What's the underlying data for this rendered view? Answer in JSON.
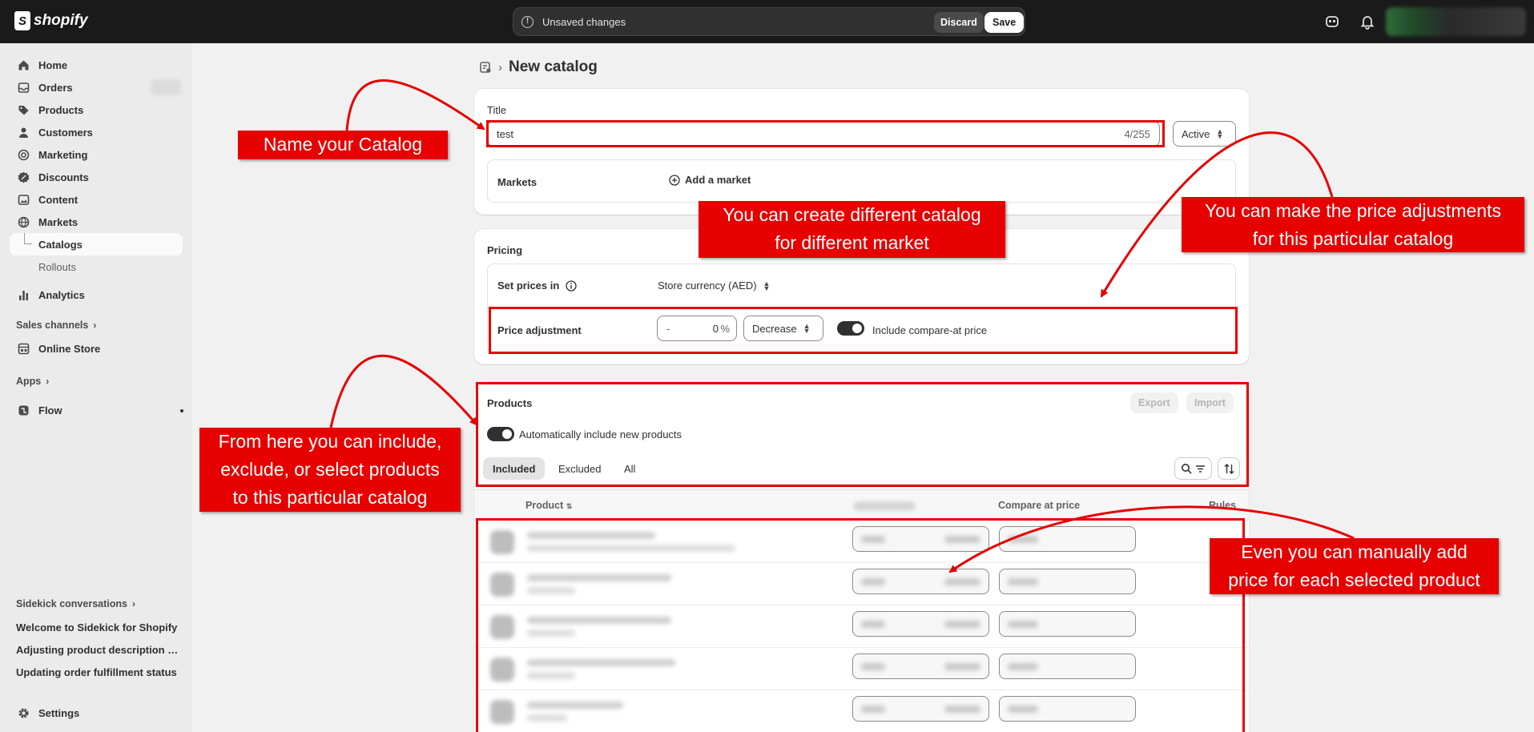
{
  "topbar": {
    "brand": "shopify",
    "status_message": "Unsaved changes",
    "discard_label": "Discard",
    "save_label": "Save"
  },
  "sidebar": {
    "items": [
      {
        "label": "Home",
        "icon": "home-icon"
      },
      {
        "label": "Orders",
        "icon": "orders-icon"
      },
      {
        "label": "Products",
        "icon": "tag-icon"
      },
      {
        "label": "Customers",
        "icon": "person-icon"
      },
      {
        "label": "Marketing",
        "icon": "target-icon"
      },
      {
        "label": "Discounts",
        "icon": "discount-icon"
      },
      {
        "label": "Content",
        "icon": "content-icon"
      },
      {
        "label": "Markets",
        "icon": "globe-icon"
      }
    ],
    "markets_sub": [
      "Catalogs",
      "Rollouts"
    ],
    "analytics": "Analytics",
    "sales_channels": "Sales channels",
    "online_store": "Online Store",
    "apps": "Apps",
    "flow": "Flow",
    "sidekick_head": "Sidekick conversations",
    "sidekick_items": [
      "Welcome to Sidekick for Shopify",
      "Adjusting product description tags",
      "Updating order fulfillment status"
    ],
    "settings": "Settings"
  },
  "page": {
    "title": "New catalog",
    "title_card": {
      "label": "Title",
      "value": "test",
      "counter": "4/255",
      "status": "Active",
      "markets_label": "Markets",
      "add_market": "Add a market"
    },
    "pricing": {
      "label": "Pricing",
      "set_prices_in": "Set prices in",
      "currency": "Store currency (AED)",
      "price_adjustment": "Price adjustment",
      "sign": "-",
      "percent_value": "0",
      "percent_symbol": "%",
      "direction": "Decrease",
      "compare_at": "Include compare-at price",
      "compare_at_on": true
    },
    "products": {
      "label": "Products",
      "export": "Export",
      "import": "Import",
      "auto_include": "Automatically include new products",
      "auto_include_on": true,
      "tabs": [
        "Included",
        "Excluded",
        "All"
      ],
      "active_tab": "Included",
      "columns": {
        "product": "Product",
        "compare_at": "Compare at price",
        "rules": "Rules"
      },
      "row_count": 5
    }
  },
  "annotations": {
    "name_catalog": "Name your Catalog",
    "different_market": "You can create different catalog\nfor different market",
    "price_adjustments": "You can make the price adjustments\nfor this particular catalog",
    "include_exclude": "From here you can include,\nexclude, or select products\nto this particular catalog",
    "manual_price": "Even you can manually add\nprice for each selected product"
  },
  "colors": {
    "annotation_red": "#e60000",
    "topbar": "#1a1a1a",
    "sidebar": "#ebebeb",
    "page_bg": "#f1f1f1"
  }
}
